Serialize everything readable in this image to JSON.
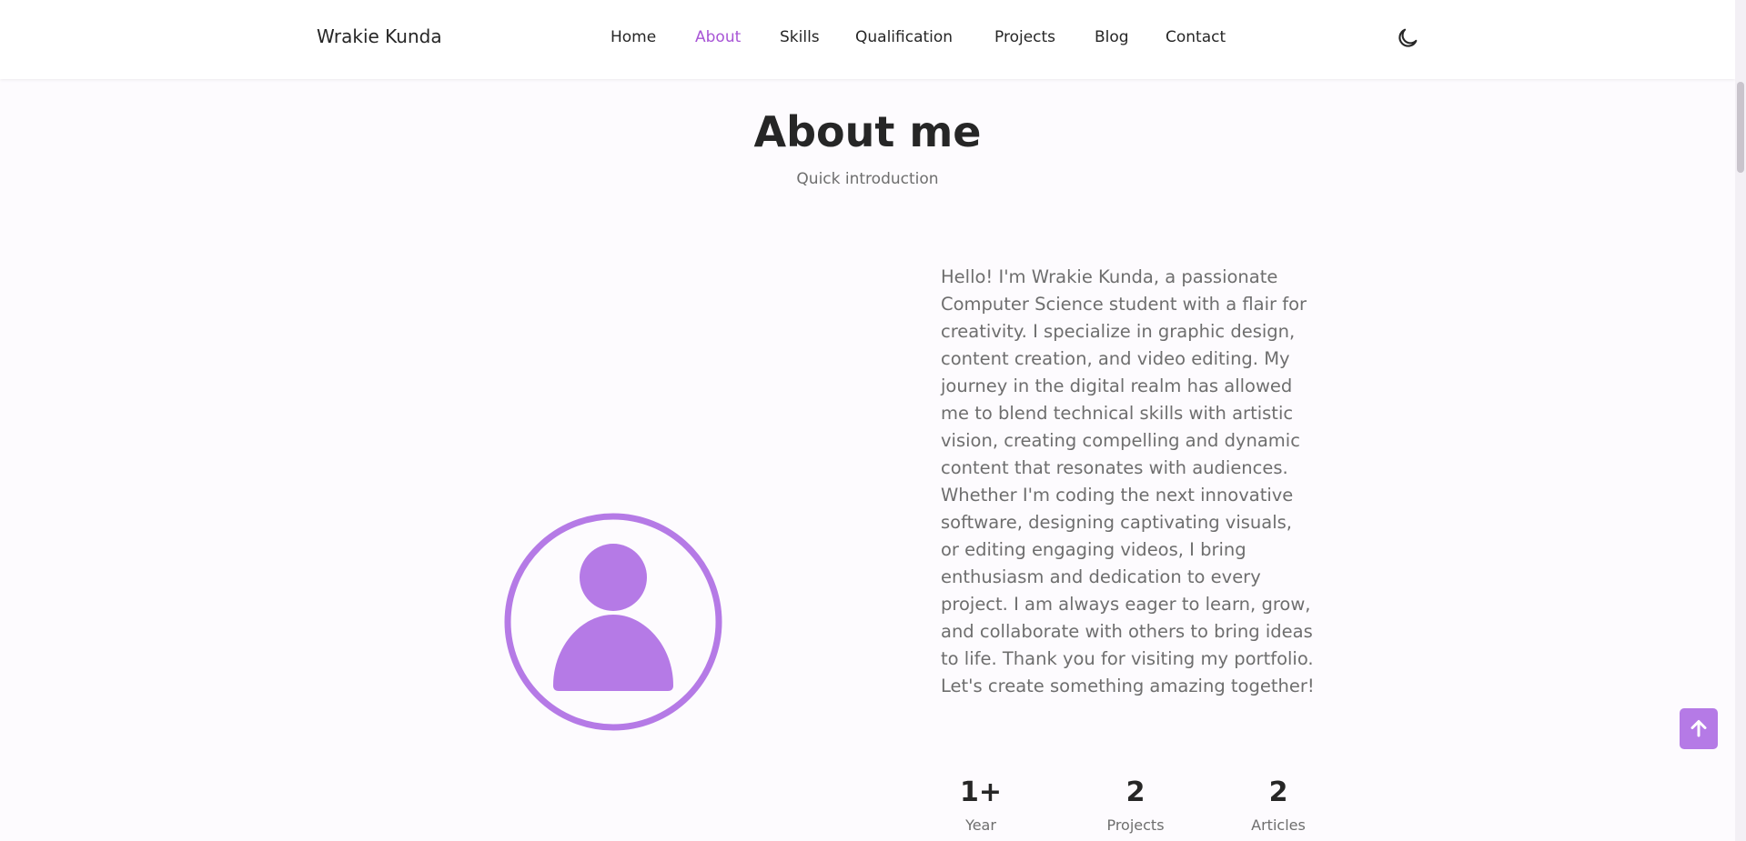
{
  "header": {
    "logo": "Wrakie Kunda",
    "nav": [
      "Home",
      "About",
      "Skills",
      "Qualification",
      "Projects",
      "Blog",
      "Contact"
    ],
    "active_nav": "About",
    "theme_icon": "moon-icon"
  },
  "about": {
    "title": "About me",
    "subtitle": "Quick introduction",
    "avatar_icon": "user-icon",
    "description": "Hello! I'm Wrakie Kunda, a passionate Computer Science student with a flair for creativity. I specialize in graphic design, content creation, and video editing. My journey in the digital realm has allowed me to blend technical skills with artistic vision, creating compelling and dynamic content that resonates with audiences. Whether I'm coding the next innovative software, designing captivating visuals, or editing engaging videos, I bring enthusiasm and dedication to every project. I am always eager to learn, grow, and collaborate with others to bring ideas to life. Thank you for visiting my portfolio. Let's create something amazing together!",
    "stats": [
      {
        "value": "1+",
        "label": "Year"
      },
      {
        "value": "2",
        "label": "Projects"
      },
      {
        "value": "2",
        "label": "Articles"
      }
    ]
  },
  "scroll_top_icon": "arrow-up-icon",
  "colors": {
    "accent": "#b57ae6",
    "active_link": "#a855d6",
    "background": "#fdfbfe",
    "heading": "#262626",
    "body_text": "#6e6e6e"
  }
}
